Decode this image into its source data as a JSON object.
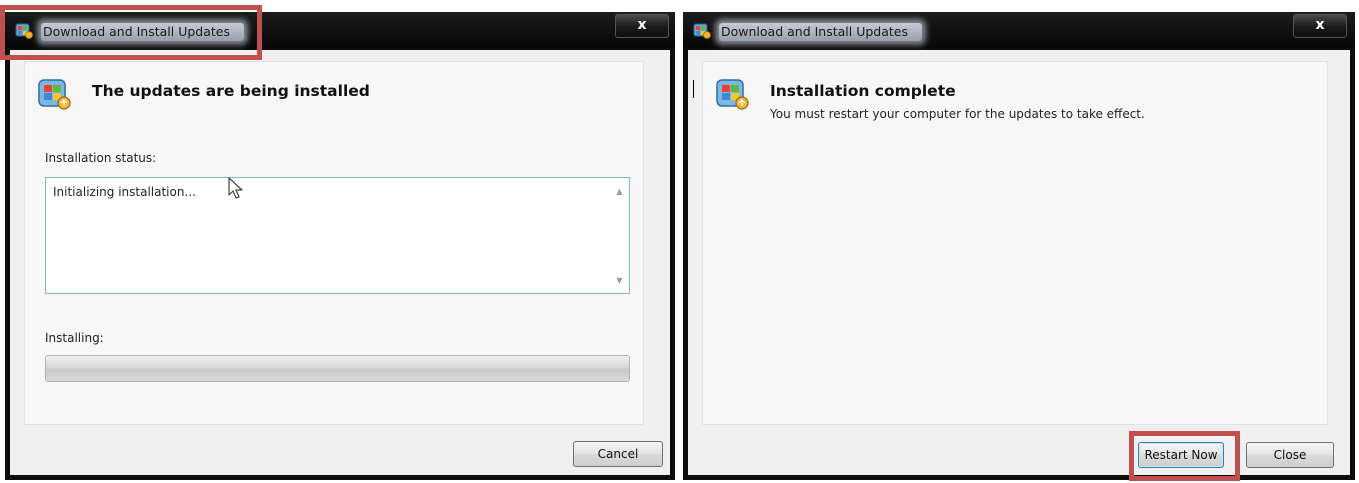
{
  "windows": [
    {
      "title": "Download and Install Updates",
      "close_glyph": "x",
      "heading": "The updates are being installed",
      "status_label": "Installation status:",
      "status_text": "Initializing installation...",
      "progress_label": "Installing:",
      "progress_value": 0,
      "cancel_label": "Cancel",
      "icons": {
        "window": "windows-update-icon",
        "heading": "windows-update-icon",
        "scroll_up": "scroll-up-arrow-icon",
        "scroll_down": "scroll-down-arrow-icon"
      }
    },
    {
      "title": "Download and Install Updates",
      "close_glyph": "x",
      "heading": "Installation complete",
      "message": "You must restart your computer for the updates to take effect.",
      "restart_label": "Restart Now",
      "close_label": "Close",
      "icons": {
        "window": "windows-update-icon",
        "heading": "windows-update-icon"
      }
    }
  ],
  "highlights": [
    "window-title",
    "restart-now-button"
  ],
  "colors": {
    "highlight": "#c0504d",
    "titlebar": "#0c0c0c",
    "client": "#f0f0f0",
    "progress_track": "#d6d6d6"
  }
}
